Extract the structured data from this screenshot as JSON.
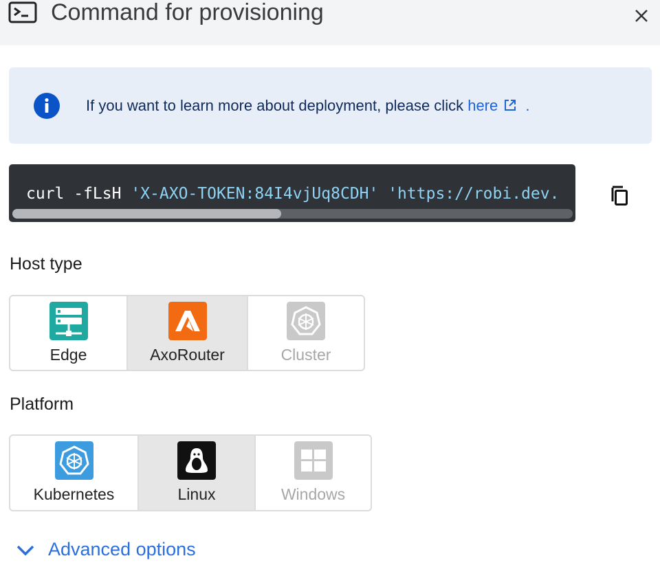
{
  "header": {
    "title": "Command for provisioning",
    "icon": "terminal-icon",
    "close_icon": "close-icon"
  },
  "info": {
    "icon": "info-icon",
    "message": "If you want to learn more about deployment, please click",
    "link_label": "here",
    "link_icon": "external-link-icon",
    "suffix": "."
  },
  "command": {
    "prefix": "curl -fLsH ",
    "token": "'X-AXO-TOKEN:84I4vjUq8CDH'",
    "url": " 'https://robi.dev.",
    "scroll_fraction": 0.48,
    "copy_icon": "copy-icon"
  },
  "host_type": {
    "label": "Host type",
    "options": [
      {
        "label": "Edge",
        "icon": "server-icon",
        "selected": false,
        "disabled": false
      },
      {
        "label": "AxoRouter",
        "icon": "axorouter-icon",
        "selected": true,
        "disabled": false
      },
      {
        "label": "Cluster",
        "icon": "kubernetes-icon",
        "selected": false,
        "disabled": true
      }
    ]
  },
  "platform": {
    "label": "Platform",
    "options": [
      {
        "label": "Kubernetes",
        "icon": "kubernetes-icon",
        "selected": false,
        "disabled": false
      },
      {
        "label": "Linux",
        "icon": "linux-icon",
        "selected": true,
        "disabled": false
      },
      {
        "label": "Windows",
        "icon": "windows-icon",
        "selected": false,
        "disabled": true
      }
    ]
  },
  "advanced": {
    "label": "Advanced options",
    "icon": "chevron-down-icon"
  },
  "colors": {
    "accent": "#2a6fdb",
    "edge": "#1fa9a0",
    "axorouter": "#f26a12",
    "kubernetes": "#3d9be0",
    "linux": "#111111",
    "disabled": "#c9c9c9"
  }
}
